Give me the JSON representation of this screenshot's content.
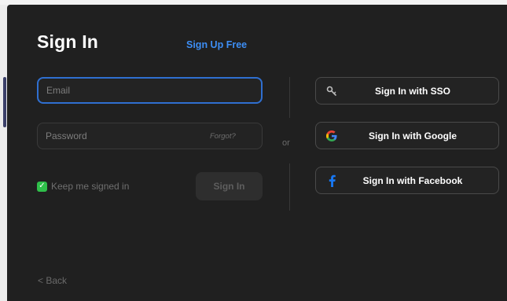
{
  "title": "Sign In",
  "signup_link": "Sign Up Free",
  "email": {
    "placeholder": "Email",
    "value": ""
  },
  "password": {
    "placeholder": "Password",
    "value": ""
  },
  "forgot_link": "Forgot?",
  "keep_signed_in": {
    "label": "Keep me signed in",
    "checked": true
  },
  "signin_button": "Sign In",
  "divider_text": "or",
  "social_buttons": [
    {
      "label": "Sign In with SSO",
      "icon": "key-icon"
    },
    {
      "label": "Sign In with Google",
      "icon": "google-icon"
    },
    {
      "label": "Sign In with Facebook",
      "icon": "facebook-icon"
    }
  ],
  "back_link": "< Back",
  "colors": {
    "background": "#202020",
    "accent": "#3d8ef5",
    "input_focus_border": "#2f6fd0",
    "checkbox": "#2fbf4a",
    "google_red": "#ea4335",
    "facebook_blue": "#1877f2"
  }
}
